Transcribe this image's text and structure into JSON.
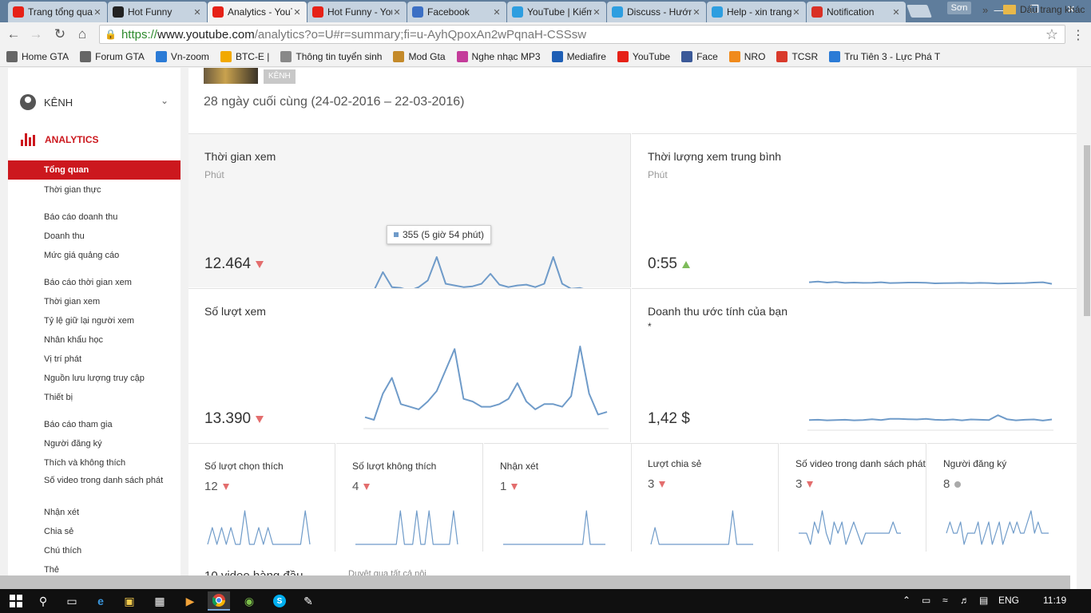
{
  "browser": {
    "tabs": [
      {
        "title": "Trang tổng quan",
        "favicon": "youtube-icon",
        "color": "#e62117",
        "active": false
      },
      {
        "title": "Hot Funny",
        "favicon": "facebook-page-icon",
        "color": "#222222",
        "active": false
      },
      {
        "title": "Analytics - YouTube",
        "favicon": "youtube-icon",
        "color": "#e62117",
        "active": true
      },
      {
        "title": "Hot Funny - YouTube",
        "favicon": "youtube-icon",
        "color": "#e62117",
        "active": false
      },
      {
        "title": "Facebook",
        "favicon": "loading-icon",
        "color": "#3b6fc4",
        "active": false
      },
      {
        "title": "YouTube | Kiếm",
        "favicon": "skype-icon",
        "color": "#2d9ee0",
        "active": false
      },
      {
        "title": "Discuss - Hướng",
        "favicon": "skype-icon",
        "color": "#2d9ee0",
        "active": false
      },
      {
        "title": "Help - xin trang",
        "favicon": "skype-icon",
        "color": "#2d9ee0",
        "active": false
      },
      {
        "title": "Notification",
        "favicon": "gmail-icon",
        "color": "#d93025",
        "active": false
      }
    ],
    "user_badge": "Sơn",
    "url": {
      "scheme": "https://",
      "host": "www.youtube.com",
      "path": "/analytics?o=U#r=summary;fi=u-AyhQpoxAn2wPqnaH-CSSsw"
    },
    "bookmarks": [
      {
        "label": "Home GTA",
        "icon": "link-icon",
        "color": "#666666"
      },
      {
        "label": "Forum GTA",
        "icon": "link-icon",
        "color": "#666666"
      },
      {
        "label": "Vn-zoom",
        "icon": "vnzoom-icon",
        "color": "#2b7bd6"
      },
      {
        "label": "BTC-E |",
        "icon": "bitcoin-icon",
        "color": "#f2a900"
      },
      {
        "label": "Thông tin tuyển sinh",
        "icon": "page-icon",
        "color": "#888888"
      },
      {
        "label": "Mod Gta",
        "icon": "mod-icon",
        "color": "#c48a2a"
      },
      {
        "label": "Nghe nhạc MP3",
        "icon": "music-icon",
        "color": "#c43c9a"
      },
      {
        "label": "Mediafire",
        "icon": "mediafire-icon",
        "color": "#1f5fb5"
      },
      {
        "label": "YouTube",
        "icon": "youtube-icon",
        "color": "#e62117"
      },
      {
        "label": "Face",
        "icon": "facebook-icon",
        "color": "#3b5998"
      },
      {
        "label": "NRO",
        "icon": "game-icon",
        "color": "#f08a1c"
      },
      {
        "label": "TCSR",
        "icon": "game-icon",
        "color": "#d93a2b"
      },
      {
        "label": "Tru Tiên 3 - Lực Phá T",
        "icon": "page-icon",
        "color": "#2b7bd6"
      }
    ],
    "bookmarks_more": "»",
    "bookmarks_other": "Dấu trang khác"
  },
  "sidebar": {
    "channel_label": "KÊNH",
    "analytics_label": "ANALYTICS",
    "items": [
      {
        "label": "Tổng quan",
        "active": true
      },
      {
        "label": "Thời gian thực"
      },
      {
        "label": "Báo cáo doanh thu"
      },
      {
        "label": "Doanh thu"
      },
      {
        "label": "Mức giá quảng cáo"
      },
      {
        "label": "Báo cáo thời gian xem"
      },
      {
        "label": "Thời gian xem"
      },
      {
        "label": "Tỷ lệ giữ lại người xem"
      },
      {
        "label": "Nhân khẩu học"
      },
      {
        "label": "Vị trí phát"
      },
      {
        "label": "Nguồn lưu lượng truy cập"
      },
      {
        "label": "Thiết bị"
      },
      {
        "label": "Báo cáo tham gia"
      },
      {
        "label": "Người đăng ký"
      },
      {
        "label": "Thích và không thích"
      },
      {
        "label": "Số video trong danh sách phát"
      },
      {
        "label": "Nhận xét"
      },
      {
        "label": "Chia sẻ"
      },
      {
        "label": "Chú thích"
      },
      {
        "label": "Thẻ"
      }
    ]
  },
  "header": {
    "badge": "KÊNH",
    "date_range": "28 ngày cuối cùng (24-02-2016 – 22-03-2016)"
  },
  "metrics": {
    "watch_time": {
      "title": "Thời gian xem",
      "unit": "Phút",
      "value": "12.464",
      "trend": "down"
    },
    "avg_duration": {
      "title": "Thời lượng xem trung bình",
      "unit": "Phút",
      "value": "0:55",
      "trend": "up"
    },
    "views": {
      "title": "Số lượt xem",
      "value": "13.390",
      "trend": "down"
    },
    "revenue": {
      "title": "Doanh thu ước tính của bạn",
      "note": "*",
      "value": "1,42 $"
    },
    "tooltip": "355 (5 giờ 54 phút)"
  },
  "small_metrics": [
    {
      "title": "Số lượt chọn thích",
      "value": "12",
      "trend": "down"
    },
    {
      "title": "Số lượt không thích",
      "value": "4",
      "trend": "down"
    },
    {
      "title": "Nhận xét",
      "value": "1",
      "trend": "down"
    },
    {
      "title": "Lượt chia sẻ",
      "value": "3",
      "trend": "down"
    },
    {
      "title": "Số video trong danh sách phát",
      "value": "3",
      "trend": "down"
    },
    {
      "title": "Người đăng ký",
      "value": "8",
      "trend": "neutral"
    }
  ],
  "bottom": {
    "title": "10 video hàng đầu",
    "link": "Duyệt qua tất cả nội"
  },
  "taskbar": {
    "language": "ENG",
    "clock": "11:19"
  },
  "colors": {
    "accent": "#cc181e",
    "chart_line": "#6f9bc9",
    "trend_down": "#e36d6d",
    "trend_up": "#7dbb5a"
  },
  "chart_data": [
    {
      "type": "line",
      "id": "watch_time",
      "x": [
        1,
        2,
        3,
        4,
        5,
        6,
        7,
        8,
        9,
        10,
        11,
        12,
        13,
        14,
        15,
        16,
        17,
        18,
        19,
        20,
        21,
        22,
        23,
        24,
        25,
        26,
        27,
        28
      ],
      "values": [
        355,
        360,
        470,
        380,
        375,
        360,
        380,
        420,
        560,
        400,
        390,
        380,
        385,
        400,
        460,
        395,
        380,
        390,
        395,
        380,
        400,
        560,
        400,
        370,
        375,
        360,
        350,
        355
      ]
    },
    {
      "type": "line",
      "id": "avg_duration",
      "x": [
        1,
        2,
        3,
        4,
        5,
        6,
        7,
        8,
        9,
        10,
        11,
        12,
        13,
        14,
        15,
        16,
        17,
        18,
        19,
        20,
        21,
        22,
        23,
        24,
        25,
        26,
        27,
        28
      ],
      "values": [
        0.62,
        0.66,
        0.6,
        0.64,
        0.58,
        0.6,
        0.58,
        0.59,
        0.62,
        0.57,
        0.58,
        0.6,
        0.6,
        0.59,
        0.55,
        0.56,
        0.57,
        0.58,
        0.56,
        0.58,
        0.57,
        0.54,
        0.55,
        0.56,
        0.57,
        0.6,
        0.62,
        0.52
      ]
    },
    {
      "type": "line",
      "id": "views",
      "x": [
        1,
        2,
        3,
        4,
        5,
        6,
        7,
        8,
        9,
        10,
        11,
        12,
        13,
        14,
        15,
        16,
        17,
        18,
        19,
        20,
        21,
        22,
        23,
        24,
        25,
        26,
        27,
        28
      ],
      "values": [
        380,
        370,
        470,
        530,
        430,
        420,
        410,
        440,
        480,
        560,
        640,
        450,
        440,
        420,
        420,
        430,
        450,
        510,
        440,
        410,
        430,
        430,
        420,
        460,
        650,
        470,
        390,
        400
      ]
    },
    {
      "type": "line",
      "id": "revenue",
      "x": [
        1,
        2,
        3,
        4,
        5,
        6,
        7,
        8,
        9,
        10,
        11,
        12,
        13,
        14,
        15,
        16,
        17,
        18,
        19,
        20,
        21,
        22,
        23,
        24,
        25,
        26,
        27,
        28
      ],
      "values": [
        0.05,
        0.06,
        0.04,
        0.05,
        0.06,
        0.04,
        0.05,
        0.08,
        0.05,
        0.09,
        0.09,
        0.08,
        0.07,
        0.09,
        0.06,
        0.05,
        0.07,
        0.04,
        0.07,
        0.06,
        0.05,
        0.22,
        0.08,
        0.04,
        0.06,
        0.07,
        0.03,
        0.07
      ]
    },
    {
      "type": "line",
      "id": "likes",
      "values": [
        0,
        2,
        0,
        2,
        0,
        2,
        0,
        0,
        4,
        0,
        0,
        2,
        0,
        2,
        0,
        0,
        0,
        0,
        0,
        0,
        0,
        4,
        0
      ]
    },
    {
      "type": "line",
      "id": "dislikes",
      "values": [
        0,
        0,
        0,
        0,
        0,
        0,
        0,
        0,
        0,
        0,
        0,
        1,
        0,
        0,
        0,
        1,
        0,
        0,
        1,
        0,
        0,
        0,
        0,
        0,
        1,
        0
      ]
    },
    {
      "type": "line",
      "id": "comments",
      "values": [
        0,
        0,
        0,
        0,
        0,
        0,
        0,
        0,
        0,
        0,
        0,
        0,
        0,
        0,
        0,
        0,
        0,
        0,
        0,
        0,
        0,
        0,
        1,
        0,
        0,
        0,
        0,
        0
      ]
    },
    {
      "type": "line",
      "id": "shares",
      "values": [
        0,
        2,
        0,
        0,
        0,
        0,
        0,
        0,
        0,
        0,
        0,
        0,
        0,
        0,
        0,
        0,
        0,
        0,
        0,
        0,
        4,
        0,
        0,
        0,
        0,
        0
      ]
    },
    {
      "type": "line",
      "id": "playlist",
      "values": [
        0,
        0,
        0,
        -1,
        1,
        0,
        2,
        0,
        -1,
        1,
        0,
        1,
        -1,
        0,
        1,
        0,
        -1,
        0,
        0,
        0,
        0,
        0,
        0,
        0,
        1,
        0,
        0
      ]
    },
    {
      "type": "line",
      "id": "subscribers",
      "values": [
        0,
        1,
        0,
        0,
        1,
        -1,
        0,
        0,
        0,
        1,
        -1,
        0,
        1,
        -1,
        0,
        1,
        -1,
        0,
        1,
        0,
        1,
        0,
        0,
        1,
        2,
        0,
        1,
        0,
        0,
        0
      ]
    }
  ]
}
